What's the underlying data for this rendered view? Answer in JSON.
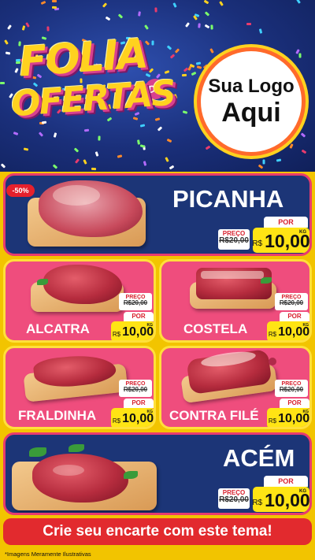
{
  "header": {
    "title_line1": "FOLIA",
    "title_de": "DE",
    "title_line2": "OFERTAS",
    "logo_line1": "Sua Logo",
    "logo_line2": "Aqui"
  },
  "labels": {
    "preco": "PREÇO",
    "por": "POR",
    "currency": "R$",
    "unit": "KG"
  },
  "products": {
    "picanha": {
      "name": "PICANHA",
      "old_price": "R$20,00",
      "price": "10,00",
      "discount": "-50%"
    },
    "alcatra": {
      "name": "ALCATRA",
      "old_price": "R$20,00",
      "price": "10,00"
    },
    "costela": {
      "name": "COSTELA",
      "old_price": "R$20,00",
      "price": "10,00"
    },
    "fraldinha": {
      "name": "FRALDINHA",
      "old_price": "R$20,00",
      "price": "10,00"
    },
    "contrafile": {
      "name": "CONTRA FILÉ",
      "old_price": "R$20,00",
      "price": "10,00"
    },
    "acem": {
      "name": "ACÉM",
      "old_price": "R$20,00",
      "price": "10,00"
    }
  },
  "cta": {
    "label": "Crie seu encarte com este tema!"
  },
  "footer": {
    "note": "*Imagens Meramente Ilustrativas"
  },
  "colors": {
    "background": "#f2c400",
    "header_blue": "#1a2f7a",
    "card_blue": "#1c3577",
    "card_pink": "#ef4d7d",
    "price_yellow": "#ffe414",
    "accent_red": "#e22a2e"
  }
}
